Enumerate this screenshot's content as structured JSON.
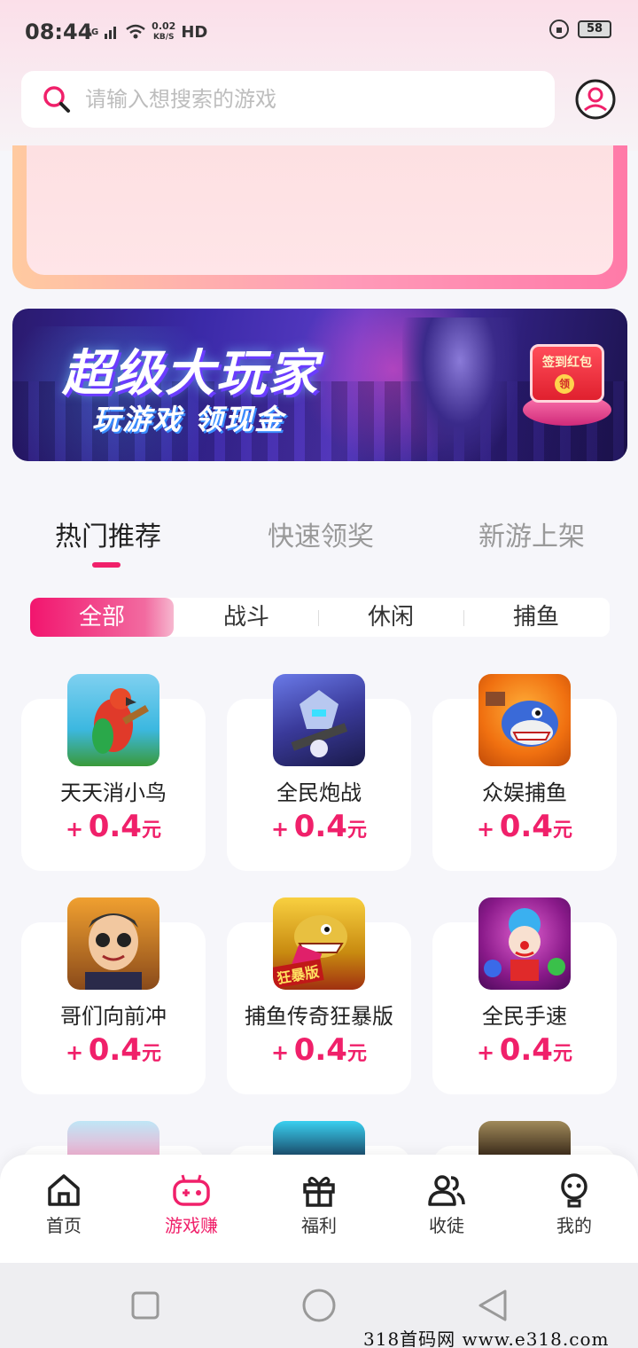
{
  "status_bar": {
    "time": "08:44",
    "network": "4G",
    "speed_value": "0.02",
    "speed_unit": "KB/S",
    "hd": "HD",
    "battery": "58"
  },
  "search": {
    "placeholder": "请输入想搜索的游戏"
  },
  "banner": {
    "title": "超级大玩家",
    "subtitle": "玩游戏 领现金",
    "redpack_label": "签到红包",
    "redpack_coin": "领"
  },
  "tabs": [
    {
      "label": "热门推荐",
      "active": true
    },
    {
      "label": "快速领奖",
      "active": false
    },
    {
      "label": "新游上架",
      "active": false
    }
  ],
  "filters": [
    {
      "label": "全部",
      "active": true
    },
    {
      "label": "战斗",
      "active": false
    },
    {
      "label": "休闲",
      "active": false
    },
    {
      "label": "捕鱼",
      "active": false
    }
  ],
  "games": [
    {
      "name": "天天消小鸟",
      "plus": "+",
      "reward": "0.4",
      "unit": "元",
      "icon": "parrot-game-icon"
    },
    {
      "name": "全民炮战",
      "plus": "+",
      "reward": "0.4",
      "unit": "元",
      "icon": "robot-warrior-game-icon"
    },
    {
      "name": "众娱捕鱼",
      "plus": "+",
      "reward": "0.4",
      "unit": "元",
      "icon": "shark-fishing-game-icon"
    },
    {
      "name": "哥们向前冲",
      "plus": "+",
      "reward": "0.4",
      "unit": "元",
      "icon": "cartoon-man-game-icon"
    },
    {
      "name": "捕鱼传奇狂暴版",
      "plus": "+",
      "reward": "0.4",
      "unit": "元",
      "icon": "gold-shark-game-icon",
      "badge": "狂暴版"
    },
    {
      "name": "全民手速",
      "plus": "+",
      "reward": "0.4",
      "unit": "元",
      "icon": "clown-game-icon"
    }
  ],
  "bottom_nav": [
    {
      "label": "首页",
      "icon": "home-icon",
      "active": false
    },
    {
      "label": "游戏赚",
      "icon": "gamepad-icon",
      "active": true
    },
    {
      "label": "福利",
      "icon": "gift-icon",
      "active": false
    },
    {
      "label": "收徒",
      "icon": "users-icon",
      "active": false
    },
    {
      "label": "我的",
      "icon": "profile-icon",
      "active": false
    }
  ],
  "watermark": "318首码网  www.e318.com",
  "colors": {
    "accent": "#f0206a",
    "background": "#f6f6fa"
  }
}
